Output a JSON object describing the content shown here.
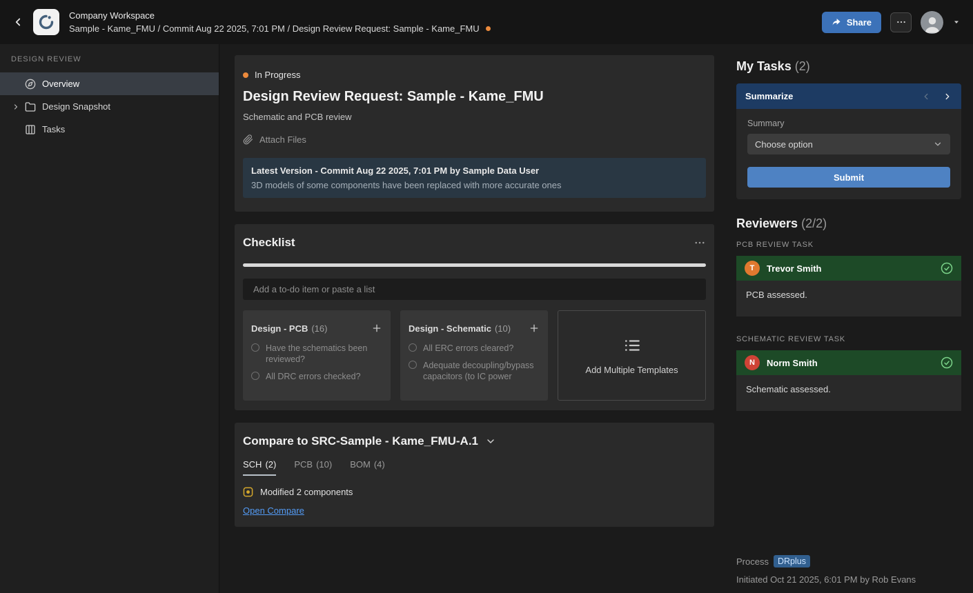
{
  "topbar": {
    "workspace": "Company Workspace",
    "breadcrumb": "Sample - Kame_FMU / Commit Aug 22 2025, 7:01 PM / Design Review Request: Sample - Kame_FMU",
    "share_label": "Share"
  },
  "sidebar": {
    "section": "DESIGN REVIEW",
    "items": [
      {
        "label": "Overview"
      },
      {
        "label": "Design Snapshot"
      },
      {
        "label": "Tasks"
      }
    ]
  },
  "main": {
    "status": "In Progress",
    "title": "Design Review Request: Sample - Kame_FMU",
    "subtitle": "Schematic and PCB review",
    "attach_label": "Attach Files",
    "latest_version": {
      "title": "Latest Version - Commit Aug 22 2025, 7:01 PM by Sample Data User",
      "description": "3D models of some components have been replaced with more accurate ones"
    },
    "checklist": {
      "title": "Checklist",
      "input_placeholder": "Add a to-do item or paste a list",
      "templates": [
        {
          "name": "Design - PCB",
          "count": "(16)",
          "items": [
            "Have the schematics been reviewed?",
            "All DRC errors checked?"
          ]
        },
        {
          "name": "Design - Schematic",
          "count": "(10)",
          "items": [
            "All ERC errors cleared?",
            "Adequate decoupling/bypass capacitors (to IC power"
          ]
        }
      ],
      "add_templates_label": "Add Multiple Templates"
    },
    "compare": {
      "title": "Compare to SRC-Sample - Kame_FMU-A.1",
      "tabs": [
        {
          "label": "SCH",
          "count": "(2)"
        },
        {
          "label": "PCB",
          "count": "(10)"
        },
        {
          "label": "BOM",
          "count": "(4)"
        }
      ],
      "modified_label": "Modified 2 components",
      "open_compare_label": "Open Compare"
    }
  },
  "right": {
    "my_tasks_title": "My Tasks",
    "my_tasks_count": "(2)",
    "summarize": {
      "title": "Summarize",
      "field_label": "Summary",
      "dropdown_value": "Choose option",
      "submit_label": "Submit"
    },
    "reviewers_title": "Reviewers",
    "reviewers_count": "(2/2)",
    "tasks": [
      {
        "section": "PCB REVIEW TASK",
        "avatar_initial": "T",
        "avatar_color": "#e0792f",
        "name": "Trevor Smith",
        "note": "PCB assessed."
      },
      {
        "section": "SCHEMATIC REVIEW TASK",
        "avatar_initial": "N",
        "avatar_color": "#cf4336",
        "name": "Norm Smith",
        "note": "Schematic assessed."
      }
    ],
    "process_label": "Process",
    "process_value": "DRplus",
    "initiated": "Initiated Oct 21 2025, 6:01 PM by Rob Evans"
  },
  "colors": {
    "status_orange": "#ec8a3c",
    "accent_blue": "#3c72b9",
    "submit_blue": "#4e82c3",
    "summarize_header": "#1d3b63",
    "reviewer_green": "#1d4a27",
    "link_blue": "#539bf5",
    "process_chip_bg": "#315f8f",
    "modified_yellow": "#d4a72c"
  }
}
